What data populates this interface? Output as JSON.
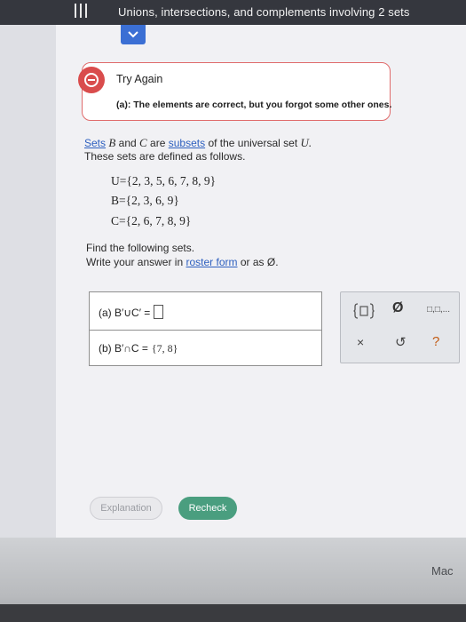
{
  "header": {
    "title": "Unions, intersections, and complements involving 2 sets"
  },
  "alert": {
    "title": "Try Again",
    "message": "(a): The elements are correct, but you forgot some other ones."
  },
  "problem": {
    "line1_sets": "Sets",
    "line1_b": "B",
    "line1_and": "and",
    "line1_c": "C",
    "line1_are": "are",
    "line1_subsets": "subsets",
    "line1_rest": "of the universal set",
    "line1_u": "U.",
    "line2": "These sets are defined as follows.",
    "sets": [
      {
        "name": "U",
        "text": "U={2, 3, 5, 6, 7, 8, 9}"
      },
      {
        "name": "B",
        "text": "B={2, 3, 6, 9}"
      },
      {
        "name": "C",
        "text": "C={2, 6, 7, 8, 9}"
      }
    ],
    "find": "Find the following sets.",
    "write_prefix": "Write your answer in",
    "write_link": "roster form",
    "write_suffix": "or as Ø."
  },
  "answers": {
    "a_label": "(a)  B′∪C′ =",
    "b_label": "(b)  B′∩C =",
    "b_value": "{7, 8}"
  },
  "tools": {
    "empty_set": "Ø",
    "pair": "□,□,...",
    "clear": "×",
    "undo": "↺",
    "help": "?"
  },
  "buttons": {
    "explanation": "Explanation",
    "recheck": "Recheck"
  },
  "bezel": {
    "brand": "Mac"
  },
  "colors": {
    "accent_blue": "#3b6fd4",
    "alert_red": "#d94c4c",
    "recheck_green": "#4a9e7f"
  }
}
